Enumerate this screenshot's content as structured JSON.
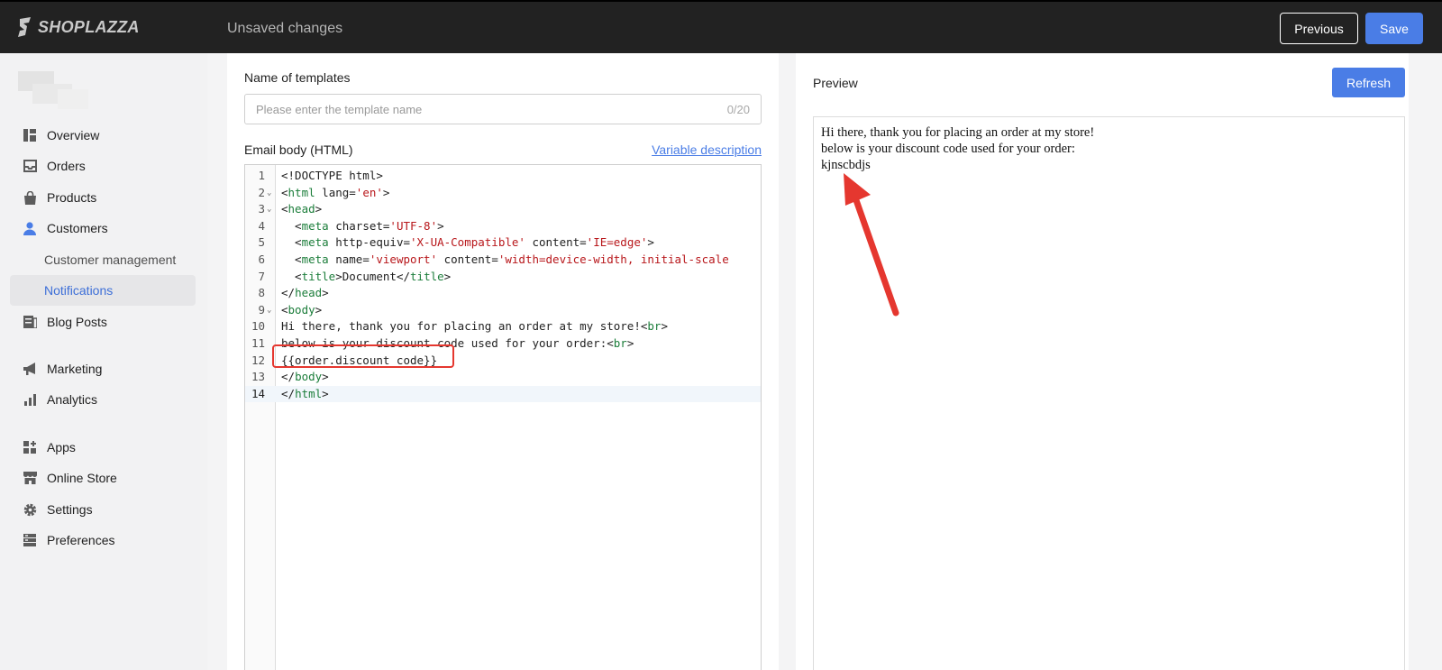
{
  "topbar": {
    "brand": "SHOPLAZZA",
    "status": "Unsaved changes",
    "previous_label": "Previous",
    "save_label": "Save"
  },
  "sidebar": {
    "items": [
      {
        "label": "Overview",
        "icon": "overview-icon"
      },
      {
        "label": "Orders",
        "icon": "inbox-icon"
      },
      {
        "label": "Products",
        "icon": "bag-icon"
      },
      {
        "label": "Customers",
        "icon": "person-icon"
      },
      {
        "label": "Customer management",
        "sub": true
      },
      {
        "label": "Notifications",
        "sub": true,
        "active": true
      },
      {
        "label": "Blog Posts",
        "icon": "blog-icon"
      },
      {
        "label": "Marketing",
        "icon": "megaphone-icon"
      },
      {
        "label": "Analytics",
        "icon": "bar-chart-icon"
      },
      {
        "label": "Apps",
        "icon": "apps-icon"
      },
      {
        "label": "Online Store",
        "icon": "store-icon"
      },
      {
        "label": "Settings",
        "icon": "gear-icon"
      },
      {
        "label": "Preferences",
        "icon": "preferences-icon"
      }
    ]
  },
  "editor_panel": {
    "name_label": "Name of templates",
    "name_placeholder": "Please enter the template name",
    "name_value": "",
    "name_counter": "0/20",
    "body_label": "Email body (HTML)",
    "variable_link": "Variable description",
    "code_lines": [
      "<!DOCTYPE html>",
      "<html lang='en'>",
      "<head>",
      "  <meta charset='UTF-8'>",
      "  <meta http-equiv='X-UA-Compatible' content='IE=edge'>",
      "  <meta name='viewport' content='width=device-width, initial-scale",
      "  <title>Document</title>",
      "</head>",
      "<body>",
      "Hi there, thank you for placing an order at my store!<br>",
      "below is your discount code used for your order:<br>",
      "{{order.discount_code}}",
      "</body>",
      "</html>"
    ],
    "line_numbers": [
      "1",
      "2",
      "3",
      "4",
      "5",
      "6",
      "7",
      "8",
      "9",
      "10",
      "11",
      "12",
      "13",
      "14"
    ],
    "current_line": 14,
    "highlighted_line": 12
  },
  "preview_panel": {
    "label": "Preview",
    "refresh_label": "Refresh",
    "lines": [
      "Hi there, thank you for placing an order at my store!",
      "below is your discount code used for your order:",
      "kjnscbdjs"
    ]
  },
  "colors": {
    "accent": "#4a7de6",
    "topbar": "#222222",
    "annotation": "#e5372f",
    "tag": "#1b7d3a",
    "string": "#b8171b"
  }
}
